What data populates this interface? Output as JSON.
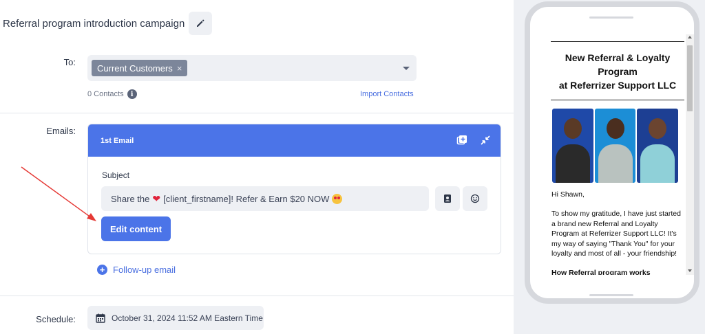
{
  "campaign": {
    "title": "Referral program introduction campaign",
    "edit_icon": "pencil-icon"
  },
  "to": {
    "label": "To:",
    "chip": "Current Customers",
    "chip_remove": "×",
    "contacts_count": "0 Contacts",
    "info_icon": "i",
    "import_link": "Import Contacts"
  },
  "emails": {
    "label": "Emails:",
    "first_email": {
      "title": "1st Email",
      "subject_label": "Subject",
      "subject_prefix": "Share the",
      "subject_suffix": "[client_firstname]! Refer & Earn $20 NOW",
      "edit_button": "Edit content"
    },
    "followup_label": "Follow-up email"
  },
  "schedule": {
    "label": "Schedule:",
    "value": "October 31, 2024 11:52 AM Eastern Time"
  },
  "preview": {
    "title_line1": "New Referral & Loyalty",
    "title_line2": "Program",
    "title_line3": "at Referrizer Support LLC",
    "greeting": "Hi Shawn,",
    "body": "To show my gratitude, I have just started a brand new Referral and Loyalty Program at Referrizer Support LLC! It's my way of saying \"Thank You\" for your loyalty and most of all - your friendship!",
    "section_heading": "How Referral program works"
  },
  "colors": {
    "accent": "#4b74e8",
    "chip": "#7c869a",
    "field_bg": "#eef0f4",
    "annotation_arrow": "#e53935"
  }
}
